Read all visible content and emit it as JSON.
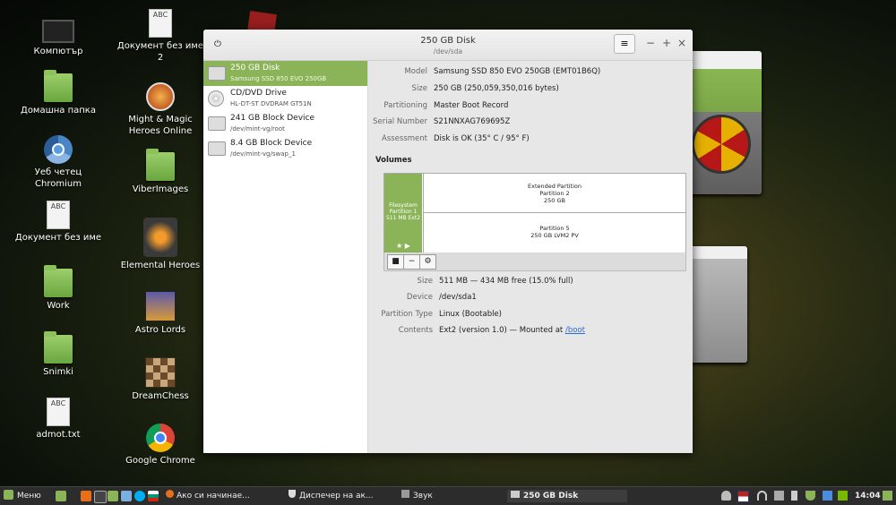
{
  "desktop": {
    "icons": [
      {
        "label": "Компютър",
        "icon": "computer-icon"
      },
      {
        "label": "Домашна папка",
        "icon": "home-folder-icon"
      },
      {
        "label": "Уеб четец Chromium",
        "icon": "chromium-icon"
      },
      {
        "label": "Документ без име",
        "icon": "text-document-icon",
        "glyph": "ABC"
      },
      {
        "label": "Work",
        "icon": "folder-icon"
      },
      {
        "label": "Snimki",
        "icon": "folder-icon"
      },
      {
        "label": "admot.txt",
        "icon": "text-document-icon",
        "glyph": "ABC"
      },
      {
        "label": "Документ без име 2",
        "icon": "text-document-icon",
        "glyph": "ABC"
      },
      {
        "label": "Might & Magic Heroes Online",
        "icon": "might-magic-icon"
      },
      {
        "label": "ViberImages",
        "icon": "folder-icon"
      },
      {
        "label": "Elemental Heroes",
        "icon": "elemental-heroes-icon"
      },
      {
        "label": "Astro Lords",
        "icon": "astro-lords-icon"
      },
      {
        "label": "DreamChess",
        "icon": "dreamchess-icon"
      },
      {
        "label": "Google Chrome",
        "icon": "chrome-icon"
      }
    ]
  },
  "window": {
    "title": "250 GB Disk",
    "subtitle": "/dev/sda",
    "menu_glyph": "≡",
    "minimize_glyph": "−",
    "maximize_glyph": "+",
    "close_glyph": "×",
    "power_glyph": "⏻"
  },
  "devices": [
    {
      "name": "250 GB Disk",
      "sub": "Samsung SSD 850 EVO 250GB",
      "selected": true
    },
    {
      "name": "CD/DVD Drive",
      "sub": "HL-DT-ST DVDRAM GT51N"
    },
    {
      "name": "241 GB Block Device",
      "sub": "/dev/mint-vg/root"
    },
    {
      "name": "8.4 GB Block Device",
      "sub": "/dev/mint-vg/swap_1"
    }
  ],
  "disk": {
    "model_label": "Model",
    "model": "Samsung SSD 850 EVO 250GB (EMT01B6Q)",
    "size_label": "Size",
    "size": "250 GB (250,059,350,016 bytes)",
    "partitioning_label": "Partitioning",
    "partitioning": "Master Boot Record",
    "serial_label": "Serial Number",
    "serial": "S21NNXAG769695Z",
    "assessment_label": "Assessment",
    "assessment": "Disk is OK (35° C / 95° F)"
  },
  "volumes": {
    "heading": "Volumes",
    "fs_line1": "Filesystem",
    "fs_line2": "Partition 1",
    "fs_line3": "511 MB Ext2",
    "fs_star": "★ ▶",
    "ext_line1": "Extended Partition",
    "ext_line2": "Partition 2",
    "ext_line3": "250 GB",
    "p5_line1": "Partition 5",
    "p5_line2": "250 GB LVM2 PV",
    "tool_stop": "■",
    "tool_minus": "−",
    "tool_gear": "⚙"
  },
  "partition": {
    "size_label": "Size",
    "size": "511 MB — 434 MB free (15.0% full)",
    "device_label": "Device",
    "device": "/dev/sda1",
    "type_label": "Partition Type",
    "type": "Linux (Bootable)",
    "contents_label": "Contents",
    "contents_prefix": "Ext2 (version 1.0) — Mounted at",
    "contents_link": "/boot"
  },
  "taskbar": {
    "menu_label": "Меню",
    "tasks": [
      "Ако си начинае...",
      "Диспечер на ак...",
      "Звук",
      "250 GB Disk"
    ],
    "clock": "14:04",
    "colors": {
      "panel": "#2c2c2c",
      "accent": "#8bb458"
    }
  }
}
